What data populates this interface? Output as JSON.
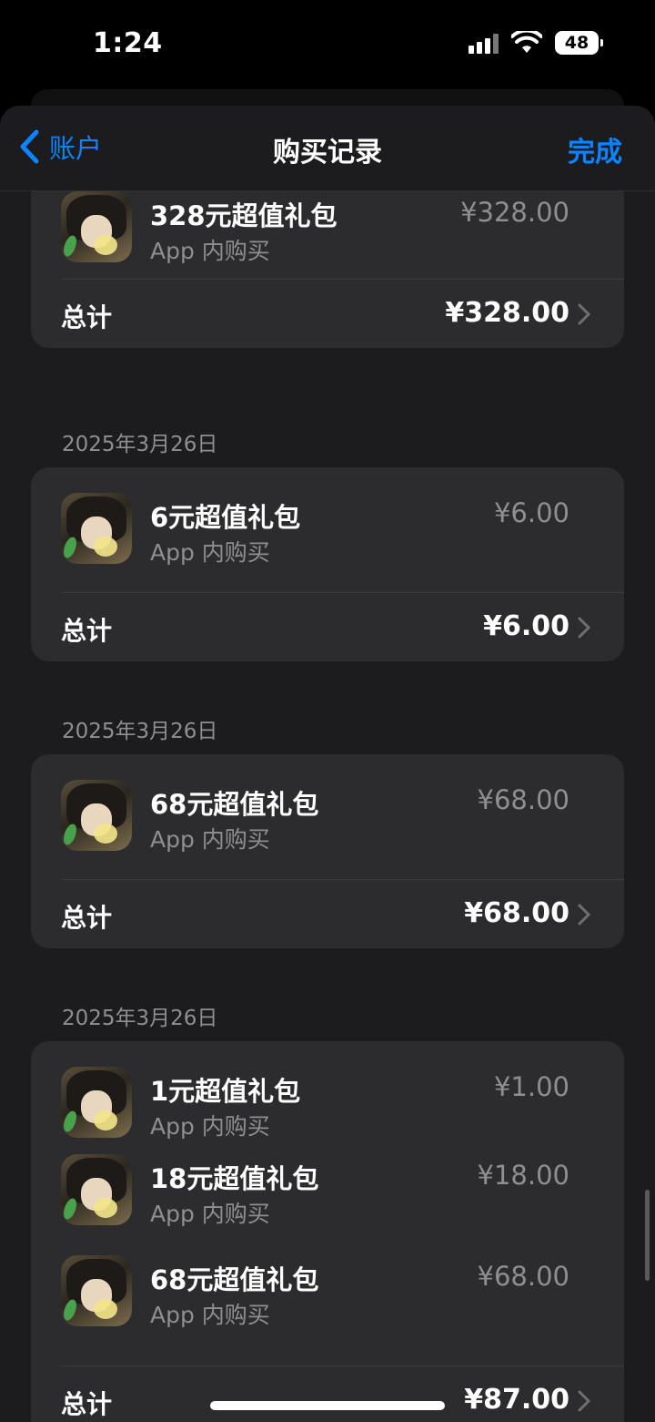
{
  "status": {
    "time": "1:24",
    "battery": "48"
  },
  "nav": {
    "back_label": "账户",
    "title": "购买记录",
    "done_label": "完成"
  },
  "groups": [
    {
      "date": "",
      "items": [
        {
          "name": "328元超值礼包",
          "type": "App 内购买",
          "price": "¥328.00"
        }
      ],
      "total_label": "总计",
      "total": "¥328.00"
    },
    {
      "date": "2025年3月26日",
      "items": [
        {
          "name": "6元超值礼包",
          "type": "App 内购买",
          "price": "¥6.00"
        }
      ],
      "total_label": "总计",
      "total": "¥6.00"
    },
    {
      "date": "2025年3月26日",
      "items": [
        {
          "name": "68元超值礼包",
          "type": "App 内购买",
          "price": "¥68.00"
        }
      ],
      "total_label": "总计",
      "total": "¥68.00"
    },
    {
      "date": "2025年3月26日",
      "items": [
        {
          "name": "1元超值礼包",
          "type": "App 内购买",
          "price": "¥1.00"
        },
        {
          "name": "18元超值礼包",
          "type": "App 内购买",
          "price": "¥18.00"
        },
        {
          "name": "68元超值礼包",
          "type": "App 内购买",
          "price": "¥68.00"
        }
      ],
      "total_label": "总计",
      "total": "¥87.00"
    }
  ],
  "colors": {
    "accent": "#0a84ff",
    "background": "#1c1c1e",
    "card": "#2c2c2e",
    "secondary_text": "#8e8e93"
  }
}
